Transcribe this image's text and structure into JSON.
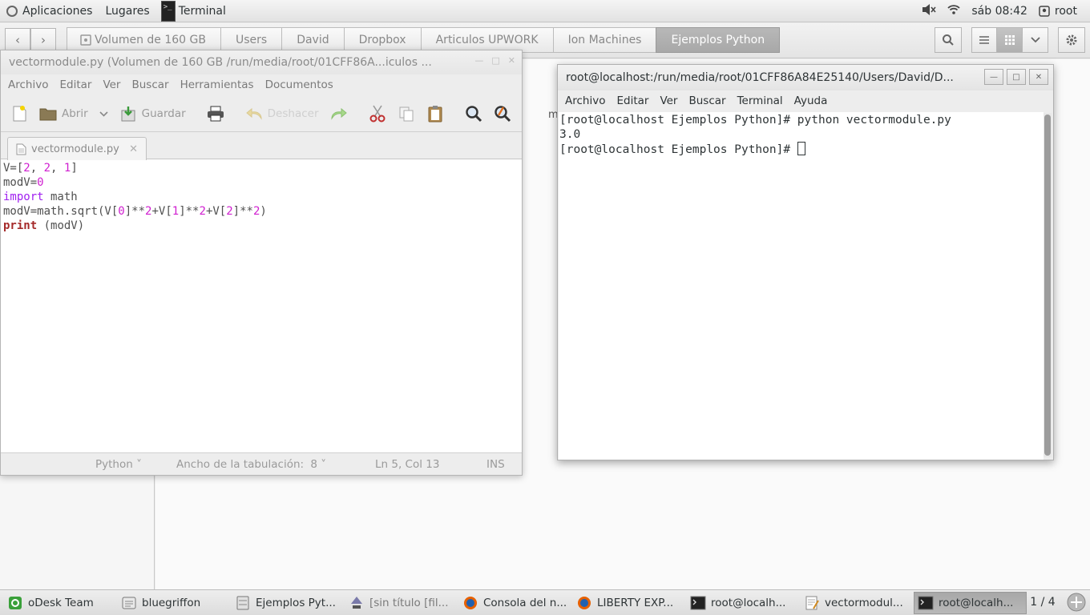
{
  "top_panel": {
    "applications": "Aplicaciones",
    "places": "Lugares",
    "active_app": "Terminal",
    "clock": "sáb 08:42",
    "user": "root"
  },
  "file_manager": {
    "path": [
      "Volumen de 160 GB",
      "Users",
      "David",
      "Dropbox",
      "Articulos UPWORK",
      "Ion Machines",
      "Ejemplos Python"
    ],
    "active_path": "Ejemplos Python",
    "peek_text": "m"
  },
  "gedit": {
    "title": "vectormodule.py (Volumen de 160 GB /run/media/root/01CFF86A...iculos ...",
    "menu": [
      "Archivo",
      "Editar",
      "Ver",
      "Buscar",
      "Herramientas",
      "Documentos"
    ],
    "toolbar": {
      "open": "Abrir",
      "save": "Guardar",
      "undo": "Deshacer"
    },
    "tab_label": "vectormodule.py",
    "code": {
      "l1": {
        "a": "V=[",
        "n1": "2",
        "b": ", ",
        "n2": "2",
        "c": ", ",
        "n3": "1",
        "d": "]"
      },
      "l2": {
        "a": "modV=",
        "n1": "0"
      },
      "l3": {
        "kw": "import",
        "rest": " math"
      },
      "l4": {
        "a": "modV=math.sqrt(V[",
        "n1": "0",
        "b": "]**",
        "n2": "2",
        "c": "+V[",
        "n3": "1",
        "d": "]**",
        "n4": "2",
        "e": "+V[",
        "n5": "2",
        "f": "]**",
        "n6": "2",
        "g": ")"
      },
      "l5": {
        "kw": "print",
        "rest": " (modV)"
      }
    },
    "status": {
      "language": "Python",
      "tab_width_label": "Ancho de la tabulación:",
      "tab_width": "8",
      "position": "Ln 5, Col 13",
      "mode": "INS"
    }
  },
  "terminal": {
    "title": "root@localhost:/run/media/root/01CFF86A84E25140/Users/David/D...",
    "menu": [
      "Archivo",
      "Editar",
      "Ver",
      "Buscar",
      "Terminal",
      "Ayuda"
    ],
    "lines": [
      "[root@localhost Ejemplos Python]# python vectormodule.py",
      "3.0",
      "[root@localhost Ejemplos Python]# "
    ]
  },
  "taskbar": {
    "tasks": [
      "oDesk Team",
      "bluegriffon",
      "Ejemplos Pyt...",
      "[sin título [fil...",
      "Consola del n...",
      "LIBERTY EXP...",
      "root@localh...",
      "vectormodul...",
      "root@localh..."
    ],
    "active_task": "root@localh...",
    "workspace": "1 / 4"
  }
}
